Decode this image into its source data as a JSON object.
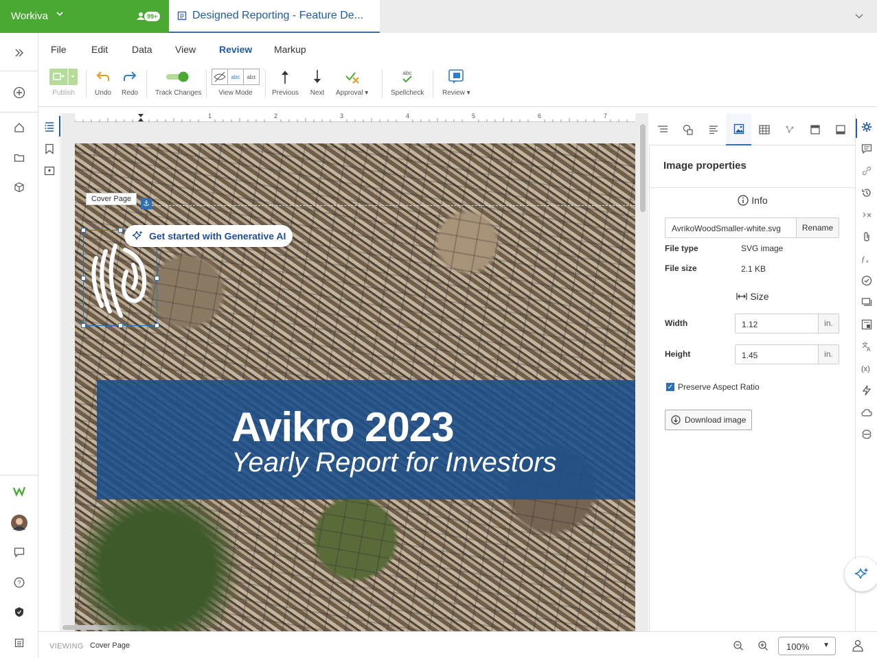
{
  "app": {
    "brand": "Workiva",
    "collab_badge": "99+",
    "doc_title": "Designed Reporting - Feature De..."
  },
  "menu": [
    "File",
    "Edit",
    "Data",
    "View",
    "Review",
    "Markup"
  ],
  "menu_active": "Review",
  "toolbar": {
    "publish": "Publish",
    "undo": "Undo",
    "redo": "Redo",
    "track_changes": "Track Changes",
    "view_mode": "View Mode",
    "previous": "Previous",
    "next": "Next",
    "approval": "Approval",
    "spellcheck": "Spellcheck",
    "review": "Review"
  },
  "ruler_marks": [
    "1",
    "2",
    "3",
    "4",
    "5",
    "6",
    "7"
  ],
  "canvas": {
    "cover_label": "Cover Page",
    "genai_label": "Get started with Generative AI",
    "banner_title": "Avikro 2023",
    "banner_subtitle": "Yearly Report for Investors"
  },
  "panel": {
    "title": "Image properties",
    "info_heading": "Info",
    "filename": "AvrikoWoodSmaller-white.svg",
    "rename": "Rename",
    "file_type_label": "File type",
    "file_type_value": "SVG image",
    "file_size_label": "File size",
    "file_size_value": "2.1 KB",
    "size_heading": "Size",
    "width_label": "Width",
    "width_value": "1.12",
    "height_label": "Height",
    "height_value": "1.45",
    "unit": "in.",
    "preserve_aspect": "Preserve Aspect Ratio",
    "preserve_checked": true,
    "download": "Download image"
  },
  "status": {
    "viewing": "VIEWING",
    "page": "Cover Page",
    "zoom": "100%"
  },
  "colors": {
    "brand_green": "#4aa933",
    "accent_blue": "#1f5aa6",
    "banner_blue": "#1b4f8c"
  }
}
